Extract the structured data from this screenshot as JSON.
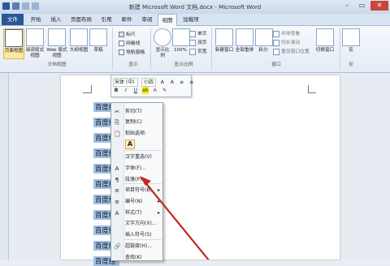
{
  "window": {
    "title": "新建 Microsoft Word 文档.docx - Microsoft Word",
    "minimize": "–",
    "restore": "▭",
    "close": "✕"
  },
  "tabs": [
    "文件",
    "开始",
    "插入",
    "页面布局",
    "引用",
    "邮件",
    "审阅",
    "视图",
    "加载项"
  ],
  "ribbon": {
    "views": {
      "labels": [
        "页面视图",
        "阅读版式\n视图",
        "Web 版式视图",
        "大纲视图",
        "草稿"
      ],
      "group": "文档视图"
    },
    "show": {
      "items": [
        "标尺",
        "网格线",
        "导航窗格"
      ],
      "group": "显示"
    },
    "zoom": {
      "labels": [
        "显示比例",
        "100%"
      ],
      "mini": [
        "单页",
        "双页",
        "页宽"
      ],
      "group": "显示比例"
    },
    "window": {
      "labels": [
        "新建窗口",
        "全部重排",
        "拆分"
      ],
      "mini": [
        "并排查看",
        "同步滚动",
        "重设窗口位置"
      ],
      "switch": "切换窗口",
      "group": "窗口"
    },
    "macro": {
      "label": "宏",
      "group": "宏"
    }
  },
  "document": {
    "line_text": "百度经",
    "line_count": 11
  },
  "mini_toolbar": {
    "font": "宋体 (中)",
    "size": "小四",
    "buttons_row1": [
      "A",
      "A",
      "≡",
      "≡"
    ],
    "buttons_row2": [
      "B",
      "I",
      "U",
      "ab",
      "A",
      "✎"
    ]
  },
  "context_menu": {
    "items": [
      {
        "icon": "✂",
        "label": "剪切(T)"
      },
      {
        "icon": "⎘",
        "label": "复制(C)"
      },
      {
        "icon": "📋",
        "label": "粘贴选项:"
      },
      {
        "icon": "",
        "label": "汉字重选(V)"
      },
      {
        "icon": "A",
        "label": "字体(F)..."
      },
      {
        "icon": "¶",
        "label": "段落(P)...",
        "arrow": ""
      },
      {
        "icon": "≡",
        "label": "项目符号(B)",
        "arrow": "▸"
      },
      {
        "icon": "≡",
        "label": "编号(N)",
        "arrow": "▸"
      },
      {
        "icon": "A",
        "label": "样式(T)",
        "arrow": "▸"
      },
      {
        "icon": "",
        "label": "文字方向(X)..."
      },
      {
        "icon": "",
        "label": "插入符号(S)"
      },
      {
        "icon": "🔗",
        "label": "超链接(H)..."
      },
      {
        "icon": "",
        "label": "查找(K)"
      }
    ],
    "paste_option": "A"
  },
  "colors": {
    "accent": "#2b5797",
    "selection": "#9fc2e6",
    "arrow": "#c0281e"
  }
}
